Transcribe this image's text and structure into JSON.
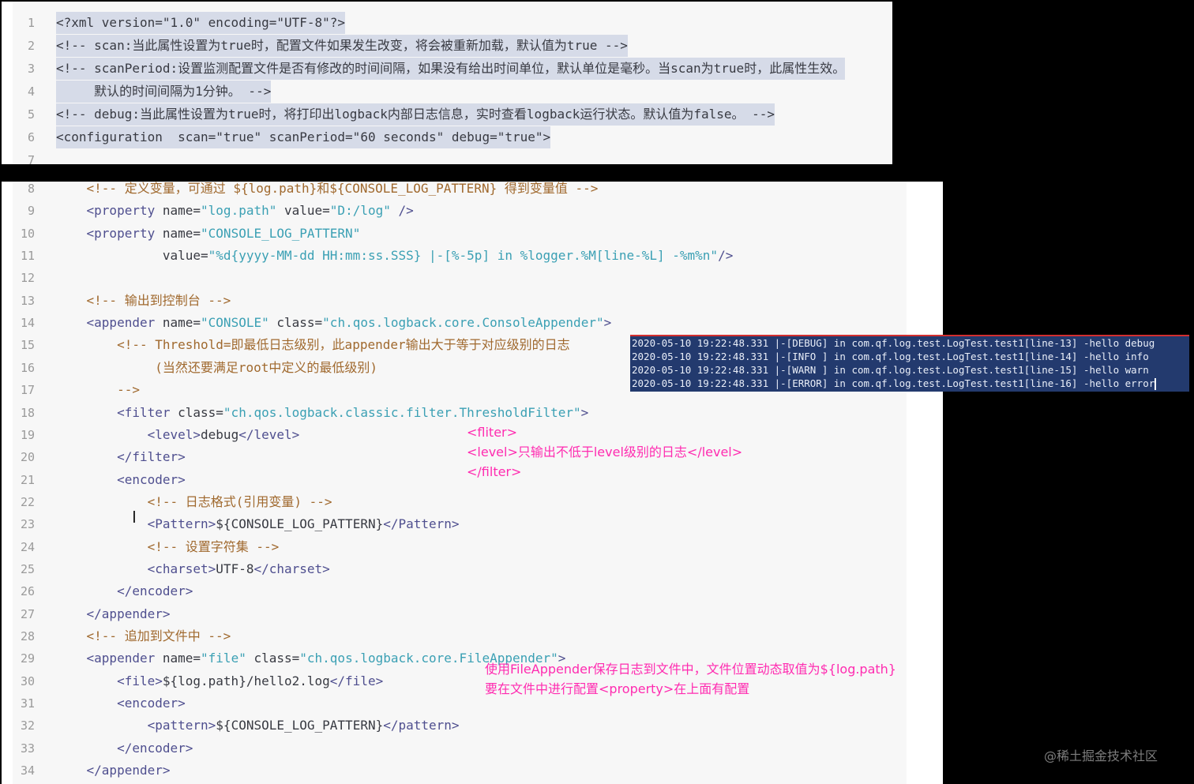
{
  "top_panel": {
    "lines": [
      {
        "num": "1",
        "segs": [
          {
            "t": "<?xml version=\"1.0\" encoding=\"UTF-8\"?>",
            "c": "c-tagplain"
          }
        ]
      },
      {
        "num": "2",
        "segs": [
          {
            "t": "<!-- scan:当此属性设置为true时，配置文件如果发生改变，将会被重新加载，默认值为true -->",
            "c": "c-tagplain"
          }
        ]
      },
      {
        "num": "3",
        "segs": [
          {
            "t": "<!-- scanPeriod:设置监测配置文件是否有修改的时间间隔，如果没有给出时间单位，默认单位是毫秒。当scan为true时，此属性生效。",
            "c": "c-tagplain"
          }
        ]
      },
      {
        "num": "4",
        "segs": [
          {
            "t": "     默认的时间间隔为1分钟。 -->",
            "c": "c-tagplain"
          }
        ]
      },
      {
        "num": "5",
        "segs": [
          {
            "t": "<!-- debug:当此属性设置为true时，将打印出logback内部日志信息，实时查看logback运行状态。默认值为false。 -->",
            "c": "c-tagplain"
          }
        ]
      },
      {
        "num": "6",
        "segs": [
          {
            "t": "<configuration  scan=\"true\" scanPeriod=\"60 seconds\" debug=\"true\">",
            "c": "c-tagplain"
          }
        ]
      },
      {
        "num": "7",
        "segs": []
      }
    ]
  },
  "main_panel": {
    "lines": [
      {
        "num": "8",
        "segs": [
          {
            "t": "    <!-- 定义变量，可通过 ${log.path}和${CONSOLE_LOG_PATTERN} 得到变量值 -->",
            "c": "c-com"
          }
        ]
      },
      {
        "num": "9",
        "segs": [
          {
            "t": "    <property ",
            "c": "c-tag"
          },
          {
            "t": "name=",
            "c": "c-attr"
          },
          {
            "t": "\"log.path\"",
            "c": "c-val"
          },
          {
            "t": " value=",
            "c": "c-attr"
          },
          {
            "t": "\"D:/log\"",
            "c": "c-val"
          },
          {
            "t": " />",
            "c": "c-tag"
          }
        ]
      },
      {
        "num": "10",
        "segs": [
          {
            "t": "    <property ",
            "c": "c-tag"
          },
          {
            "t": "name=",
            "c": "c-attr"
          },
          {
            "t": "\"CONSOLE_LOG_PATTERN\"",
            "c": "c-val"
          }
        ]
      },
      {
        "num": "11",
        "segs": [
          {
            "t": "              value=",
            "c": "c-attr"
          },
          {
            "t": "\"%d{yyyy-MM-dd HH:mm:ss.SSS} |-[%-5p] in %logger.%M[line-%L] -%m%n\"",
            "c": "c-val"
          },
          {
            "t": "/>",
            "c": "c-tag"
          }
        ]
      },
      {
        "num": "12",
        "segs": []
      },
      {
        "num": "13",
        "segs": [
          {
            "t": "    <!-- 输出到控制台 -->",
            "c": "c-com"
          }
        ]
      },
      {
        "num": "14",
        "segs": [
          {
            "t": "    <appender ",
            "c": "c-tag"
          },
          {
            "t": "name=",
            "c": "c-attr"
          },
          {
            "t": "\"CONSOLE\"",
            "c": "c-val"
          },
          {
            "t": " class=",
            "c": "c-attr"
          },
          {
            "t": "\"ch.qos.logback.core.ConsoleAppender\"",
            "c": "c-val"
          },
          {
            "t": ">",
            "c": "c-tag"
          }
        ]
      },
      {
        "num": "15",
        "segs": [
          {
            "t": "        <!-- Threshold=即最低日志级别，此appender输出大于等于对应级别的日志",
            "c": "c-com"
          }
        ]
      },
      {
        "num": "16",
        "segs": [
          {
            "t": "             (当然还要满足root中定义的最低级别)",
            "c": "c-com"
          }
        ]
      },
      {
        "num": "17",
        "segs": [
          {
            "t": "        -->",
            "c": "c-com"
          }
        ]
      },
      {
        "num": "18",
        "segs": [
          {
            "t": "        <filter ",
            "c": "c-tag"
          },
          {
            "t": "class=",
            "c": "c-attr"
          },
          {
            "t": "\"ch.qos.logback.classic.filter.ThresholdFilter\"",
            "c": "c-val"
          },
          {
            "t": ">",
            "c": "c-tag"
          }
        ]
      },
      {
        "num": "19",
        "segs": [
          {
            "t": "            <level>",
            "c": "c-tag"
          },
          {
            "t": "debug",
            "c": "c-tagplain"
          },
          {
            "t": "</level>",
            "c": "c-tag"
          }
        ]
      },
      {
        "num": "20",
        "segs": [
          {
            "t": "        </filter>",
            "c": "c-tag"
          }
        ]
      },
      {
        "num": "21",
        "segs": [
          {
            "t": "        <encoder>",
            "c": "c-tag"
          }
        ]
      },
      {
        "num": "22",
        "segs": [
          {
            "t": "            <!-- 日志格式(引用变量) -->",
            "c": "c-com"
          }
        ]
      },
      {
        "num": "23",
        "segs": [
          {
            "t": "            <Pattern>",
            "c": "c-tag"
          },
          {
            "t": "${CONSOLE_LOG_PATTERN}",
            "c": "c-tagplain"
          },
          {
            "t": "</Pattern>",
            "c": "c-tag"
          }
        ]
      },
      {
        "num": "24",
        "segs": [
          {
            "t": "            <!-- 设置字符集 -->",
            "c": "c-com"
          }
        ]
      },
      {
        "num": "25",
        "segs": [
          {
            "t": "            <charset>",
            "c": "c-tag"
          },
          {
            "t": "UTF-8",
            "c": "c-tagplain"
          },
          {
            "t": "</charset>",
            "c": "c-tag"
          }
        ]
      },
      {
        "num": "26",
        "segs": [
          {
            "t": "        </encoder>",
            "c": "c-tag"
          }
        ]
      },
      {
        "num": "27",
        "segs": [
          {
            "t": "    </appender>",
            "c": "c-tag"
          }
        ]
      },
      {
        "num": "28",
        "segs": [
          {
            "t": "    <!-- 追加到文件中 -->",
            "c": "c-com"
          }
        ]
      },
      {
        "num": "29",
        "segs": [
          {
            "t": "    <appender ",
            "c": "c-tag"
          },
          {
            "t": "name=",
            "c": "c-attr"
          },
          {
            "t": "\"file\"",
            "c": "c-val"
          },
          {
            "t": " class=",
            "c": "c-attr"
          },
          {
            "t": "\"ch.qos.logback.core.FileAppender\"",
            "c": "c-val"
          },
          {
            "t": ">",
            "c": "c-tag"
          }
        ]
      },
      {
        "num": "30",
        "segs": [
          {
            "t": "        <file>",
            "c": "c-tag"
          },
          {
            "t": "${log.path}/hello2.log",
            "c": "c-tagplain"
          },
          {
            "t": "</file>",
            "c": "c-tag"
          }
        ]
      },
      {
        "num": "31",
        "segs": [
          {
            "t": "        <encoder>",
            "c": "c-tag"
          }
        ]
      },
      {
        "num": "32",
        "segs": [
          {
            "t": "            <pattern>",
            "c": "c-tag"
          },
          {
            "t": "${CONSOLE_LOG_PATTERN}",
            "c": "c-tagplain"
          },
          {
            "t": "</pattern>",
            "c": "c-tag"
          }
        ]
      },
      {
        "num": "33",
        "segs": [
          {
            "t": "        </encoder>",
            "c": "c-tag"
          }
        ]
      },
      {
        "num": "34",
        "segs": [
          {
            "t": "    </appender>",
            "c": "c-tag"
          }
        ]
      }
    ]
  },
  "console_output": [
    "2020-05-10 19:22:48.331 |-[DEBUG] in com.qf.log.test.LogTest.test1[line-13] -hello debug",
    "2020-05-10 19:22:48.331 |-[INFO ] in com.qf.log.test.LogTest.test1[line-14] -hello info",
    "2020-05-10 19:22:48.331 |-[WARN ] in com.qf.log.test.LogTest.test1[line-15] -hello warn",
    "2020-05-10 19:22:48.331 |-[ERROR] in com.qf.log.test.LogTest.test1[line-16] -hello error"
  ],
  "annotations": {
    "filter_note": "<fliter>\n<level>只输出不低于level级别的日志</level>\n</filter>",
    "file_note": "使用FileAppender保存日志到文件中，文件位置动态取值为${log.path}\n要在文件中进行配置<property>在上面有配置"
  },
  "watermark": "@稀土掘金技术社区",
  "colors": {
    "comment": "#a0692e",
    "tag": "#4f4f8f",
    "value": "#3ba0b4",
    "annotation": "#ff2bb0",
    "console_bg": "#233a6e",
    "selection": "#d6dbe8"
  }
}
